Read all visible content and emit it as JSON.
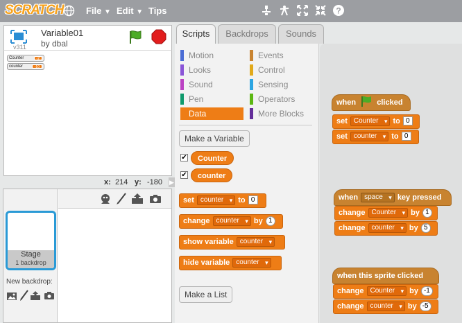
{
  "menubar": {
    "logo": "SCRATCH",
    "file": "File",
    "edit": "Edit",
    "tips": "Tips",
    "tools": [
      "duplicate-icon",
      "cut-icon",
      "grow-icon",
      "shrink-icon",
      "help-icon"
    ]
  },
  "project": {
    "title": "Variable01",
    "author": "by dbal",
    "version": "v311"
  },
  "stage_monitors": [
    {
      "name": "Counter",
      "value": "-2"
    },
    {
      "name": "counter",
      "value": "-10"
    }
  ],
  "coords": {
    "x_label": "x:",
    "x": "214",
    "y_label": "y:",
    "y": "-180"
  },
  "stage_item": {
    "name": "Stage",
    "detail": "1 backdrop"
  },
  "new_backdrop_label": "New backdrop:",
  "tabs": [
    "Scripts",
    "Backdrops",
    "Sounds"
  ],
  "categories": {
    "left": [
      {
        "label": "Motion",
        "color": "#4a6cd4"
      },
      {
        "label": "Looks",
        "color": "#8a55d7"
      },
      {
        "label": "Sound",
        "color": "#bb42c3"
      },
      {
        "label": "Pen",
        "color": "#0e9a6c"
      },
      {
        "label": "Data",
        "color": "#ee7d16"
      }
    ],
    "right": [
      {
        "label": "Events",
        "color": "#c88330"
      },
      {
        "label": "Control",
        "color": "#e1a91a"
      },
      {
        "label": "Sensing",
        "color": "#2ca5e2"
      },
      {
        "label": "Operators",
        "color": "#5cb712"
      },
      {
        "label": "More Blocks",
        "color": "#632d99"
      }
    ]
  },
  "palette": {
    "make_variable": "Make a Variable",
    "variables": [
      "Counter",
      "counter"
    ],
    "check_mark": "✔",
    "blocks": {
      "set": {
        "kw": "set",
        "var": "counter",
        "to": "to",
        "val": "0"
      },
      "change": {
        "kw": "change",
        "var": "counter",
        "by": "by",
        "val": "1"
      },
      "show": {
        "kw": "show variable",
        "var": "counter"
      },
      "hide": {
        "kw": "hide variable",
        "var": "counter"
      }
    },
    "make_list": "Make a List"
  },
  "scripts": {
    "script1": {
      "hat_when": "when",
      "hat_clicked": "clicked",
      "b1": {
        "kw": "set",
        "var": "Counter",
        "to": "to",
        "val": "0"
      },
      "b2": {
        "kw": "set",
        "var": "counter",
        "to": "to",
        "val": "0"
      }
    },
    "script2": {
      "hat_when": "when",
      "hat_key": "space",
      "hat_rest": "key pressed",
      "b1": {
        "kw": "change",
        "var": "Counter",
        "by": "by",
        "val": "1"
      },
      "b2": {
        "kw": "change",
        "var": "counter",
        "by": "by",
        "val": "5"
      }
    },
    "script3": {
      "hat": "when this sprite clicked",
      "b1": {
        "kw": "change",
        "var": "Counter",
        "by": "by",
        "val": "-1"
      },
      "b2": {
        "kw": "change",
        "var": "counter",
        "by": "by",
        "val": "-5"
      }
    }
  }
}
